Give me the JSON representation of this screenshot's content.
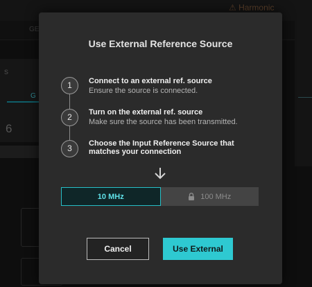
{
  "background": {
    "harmonic_label": "Harmonic",
    "tab_label": "G",
    "value": "6"
  },
  "modal": {
    "title": "Use External Reference Source",
    "steps": [
      {
        "number": "1",
        "title": "Connect to an external ref. source",
        "subtitle": "Ensure the source is connected."
      },
      {
        "number": "2",
        "title": "Turn on the external ref. source",
        "subtitle": "Make sure the source has been transmitted."
      },
      {
        "number": "3",
        "title": "Choose the Input Reference Source that matches your connection",
        "subtitle": ""
      }
    ],
    "frequency_options": [
      {
        "label": "10 MHz",
        "state": "selected"
      },
      {
        "label": "100 MHz",
        "state": "locked",
        "icon": "lock-icon"
      }
    ],
    "cancel_label": "Cancel",
    "confirm_label": "Use External"
  },
  "colors": {
    "accent": "#2ec9d1",
    "modal_bg": "#2b2b2b",
    "backdrop": "#0e0e0e"
  }
}
